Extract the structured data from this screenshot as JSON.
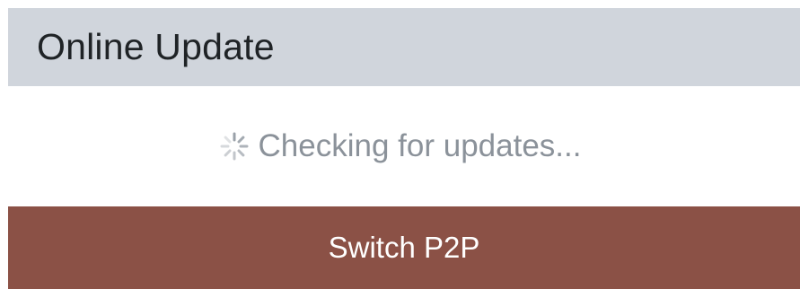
{
  "header": {
    "title": "Online Update"
  },
  "status": {
    "text": "Checking for updates...",
    "icon": "spinner-icon"
  },
  "actions": {
    "switch_label": "Switch P2P"
  },
  "colors": {
    "header_bg": "#d0d5dc",
    "button_bg": "#8b5146",
    "status_text": "#8b929a"
  }
}
